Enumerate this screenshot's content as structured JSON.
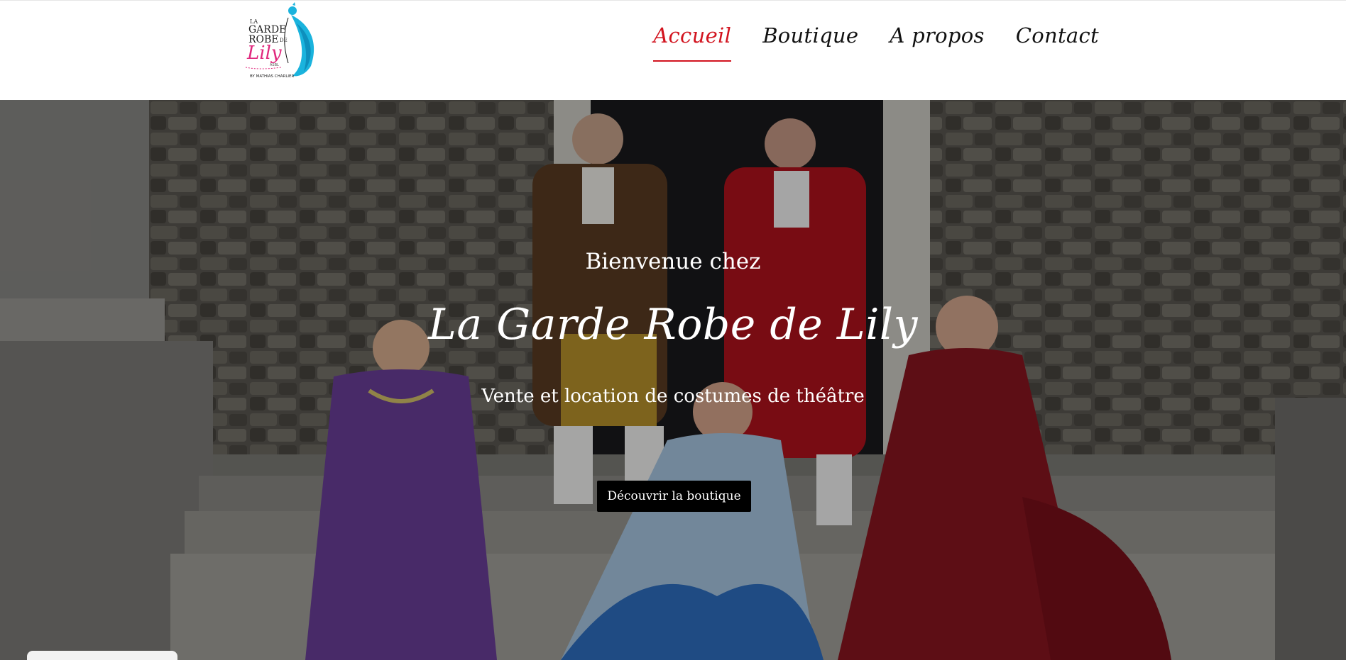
{
  "header": {
    "logo": {
      "line1": "LA",
      "line2": "GARDE",
      "line3": "ROBE",
      "line3b": "DE",
      "line4": "Lily",
      "line5": "ASBL",
      "line6": "BY MATHIAS CHARLIER"
    },
    "nav": [
      {
        "label": "Accueil",
        "active": true
      },
      {
        "label": "Boutique",
        "active": false
      },
      {
        "label": "A propos",
        "active": false
      },
      {
        "label": "Contact",
        "active": false
      }
    ]
  },
  "hero": {
    "pre_title": "Bienvenue chez",
    "title": "La Garde Robe de Lily",
    "subtitle": "Vente et location de costumes de théâtre",
    "cta_label": "Découvrir la boutique"
  },
  "colors": {
    "accent": "#d2141f",
    "logo_pink": "#e0287d",
    "logo_blue": "#1ab3dd",
    "button_bg": "#000000"
  }
}
